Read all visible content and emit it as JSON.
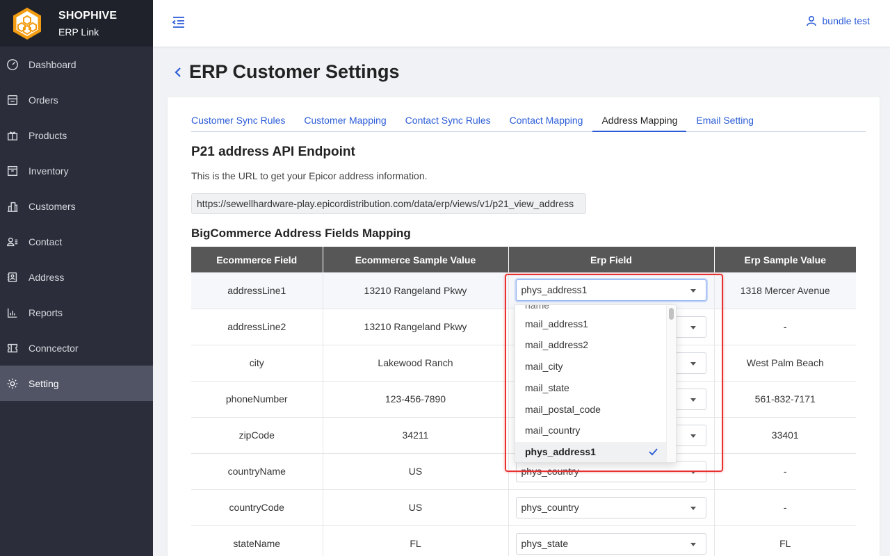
{
  "brand": {
    "name": "SHOPHIVE",
    "subtitle": "ERP Link"
  },
  "sidebar": {
    "items": [
      {
        "label": "Dashboard",
        "icon": "gauge-icon"
      },
      {
        "label": "Orders",
        "icon": "orders-icon"
      },
      {
        "label": "Products",
        "icon": "gift-icon"
      },
      {
        "label": "Inventory",
        "icon": "archive-icon"
      },
      {
        "label": "Customers",
        "icon": "buildings-icon"
      },
      {
        "label": "Contact",
        "icon": "contact-icon"
      },
      {
        "label": "Address",
        "icon": "address-book-icon"
      },
      {
        "label": "Reports",
        "icon": "bar-chart-icon"
      },
      {
        "label": "Conncector",
        "icon": "ticket-icon"
      },
      {
        "label": "Setting",
        "icon": "gear-icon",
        "active": true
      }
    ]
  },
  "header": {
    "user_name": "bundle test"
  },
  "page": {
    "title": "ERP Customer Settings"
  },
  "tabs": [
    {
      "label": "Customer Sync Rules"
    },
    {
      "label": "Customer Mapping"
    },
    {
      "label": "Contact Sync Rules"
    },
    {
      "label": "Contact Mapping"
    },
    {
      "label": "Address Mapping",
      "active": true
    },
    {
      "label": "Email Setting"
    }
  ],
  "endpoint": {
    "title": "P21 address API Endpoint",
    "description": "This is the URL to get your Epicor address information.",
    "url": "https://sewellhardware-play.epicordistribution.com/data/erp/views/v1/p21_view_address"
  },
  "mapping": {
    "title": "BigCommerce Address Fields Mapping",
    "columns": [
      "Ecommerce Field",
      "Ecommerce Sample Value",
      "Erp Field",
      "Erp Sample Value"
    ],
    "rows": [
      {
        "field": "addressLine1",
        "sample": "13210 Rangeland Pkwy",
        "erp": "phys_address1",
        "erp_sample": "1318 Mercer Avenue"
      },
      {
        "field": "addressLine2",
        "sample": "13210 Rangeland Pkwy",
        "erp": "",
        "erp_sample": "-"
      },
      {
        "field": "city",
        "sample": "Lakewood Ranch",
        "erp": "",
        "erp_sample": "West Palm Beach"
      },
      {
        "field": "phoneNumber",
        "sample": "123-456-7890",
        "erp": "",
        "erp_sample": "561-832-7171"
      },
      {
        "field": "zipCode",
        "sample": "34211",
        "erp": "",
        "erp_sample": "33401"
      },
      {
        "field": "countryName",
        "sample": "US",
        "erp": "phys_country",
        "erp_sample": "-"
      },
      {
        "field": "countryCode",
        "sample": "US",
        "erp": "phys_country",
        "erp_sample": "-"
      },
      {
        "field": "stateName",
        "sample": "FL",
        "erp": "phys_state",
        "erp_sample": "FL"
      }
    ]
  },
  "dropdown": {
    "partial_top": "name",
    "options": [
      "mail_address1",
      "mail_address2",
      "mail_city",
      "mail_state",
      "mail_postal_code",
      "mail_country",
      "phys_address1"
    ],
    "selected": "phys_address1"
  },
  "colors": {
    "accent": "#2a5bd7",
    "sidebar": "#2b2e3a",
    "highlight": "#e8312f",
    "table_header": "#575757"
  }
}
